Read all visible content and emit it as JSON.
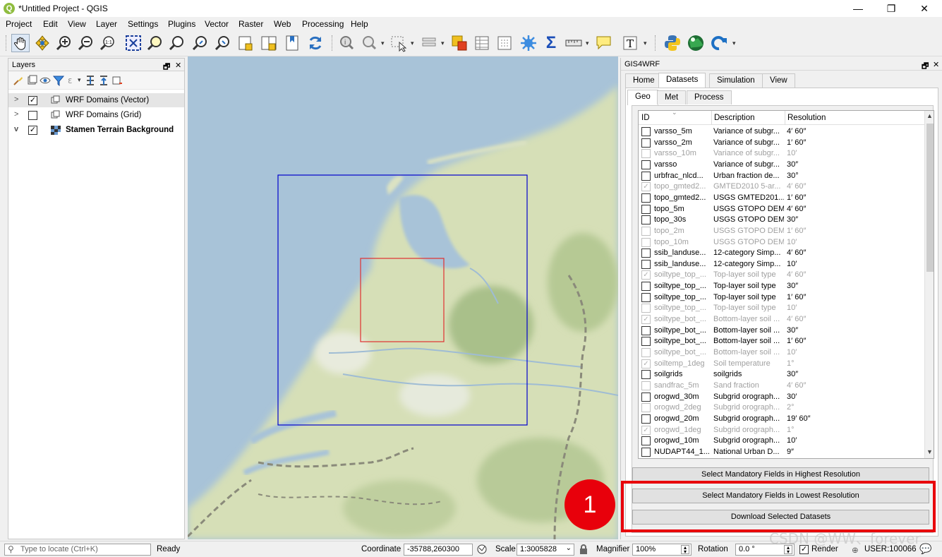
{
  "window": {
    "title": "*Untitled Project - QGIS",
    "minimize": "—",
    "maximize": "❐",
    "close": "✕"
  },
  "menu": [
    "Project",
    "Edit",
    "View",
    "Layer",
    "Settings",
    "Plugins",
    "Vector",
    "Raster",
    "Web",
    "Processing",
    "Help"
  ],
  "layers_panel": {
    "title": "Layers",
    "float": "🗗",
    "close": "✕",
    "layers": [
      {
        "name": "WRF Domains (Vector)",
        "checked": true,
        "expander": ">",
        "bold": false,
        "selected": true
      },
      {
        "name": "WRF Domains (Grid)",
        "checked": false,
        "expander": ">",
        "bold": false,
        "selected": false
      },
      {
        "name": "Stamen Terrain Background",
        "checked": true,
        "expander": "v",
        "bold": true,
        "selected": false
      }
    ]
  },
  "gis_panel": {
    "title": "GIS4WRF",
    "float": "🗗",
    "close": "✕",
    "tabs": [
      "Home",
      "Datasets",
      "Simulation",
      "View"
    ],
    "active_tab": "Datasets",
    "subtabs": [
      "Geo",
      "Met",
      "Process"
    ],
    "active_subtab": "Geo",
    "columns": [
      "ID",
      "Description",
      "Resolution"
    ],
    "rows": [
      {
        "id": "varsso_5m",
        "desc": "Variance of subgr...",
        "res": "4′ 60″",
        "checked": false,
        "disabled": false
      },
      {
        "id": "varsso_2m",
        "desc": "Variance of subgr...",
        "res": "1′ 60″",
        "checked": false,
        "disabled": false
      },
      {
        "id": "varsso_10m",
        "desc": "Variance of subgr...",
        "res": "10′",
        "checked": false,
        "disabled": true
      },
      {
        "id": "varsso",
        "desc": "Variance of subgr...",
        "res": "30″",
        "checked": false,
        "disabled": false
      },
      {
        "id": "urbfrac_nlcd...",
        "desc": "Urban fraction de...",
        "res": "30°",
        "checked": false,
        "disabled": false
      },
      {
        "id": "topo_gmted2...",
        "desc": "GMTED2010 5-ar...",
        "res": "4′ 60″",
        "checked": true,
        "disabled": true
      },
      {
        "id": "topo_gmted2...",
        "desc": "USGS GMTED201...",
        "res": "1′ 60″",
        "checked": false,
        "disabled": false
      },
      {
        "id": "topo_5m",
        "desc": "USGS GTOPO DEM",
        "res": "4′ 60″",
        "checked": false,
        "disabled": false
      },
      {
        "id": "topo_30s",
        "desc": "USGS GTOPO DEM",
        "res": "30″",
        "checked": false,
        "disabled": false
      },
      {
        "id": "topo_2m",
        "desc": "USGS GTOPO DEM",
        "res": "1′ 60″",
        "checked": false,
        "disabled": true
      },
      {
        "id": "topo_10m",
        "desc": "USGS GTOPO DEM",
        "res": "10′",
        "checked": false,
        "disabled": true
      },
      {
        "id": "ssib_landuse...",
        "desc": "12-category Simp...",
        "res": "4′ 60″",
        "checked": false,
        "disabled": false
      },
      {
        "id": "ssib_landuse...",
        "desc": "12-category Simp...",
        "res": "10′",
        "checked": false,
        "disabled": false
      },
      {
        "id": "soiltype_top_...",
        "desc": "Top-layer soil type",
        "res": "4′ 60″",
        "checked": true,
        "disabled": true
      },
      {
        "id": "soiltype_top_...",
        "desc": "Top-layer soil type",
        "res": "30″",
        "checked": false,
        "disabled": false
      },
      {
        "id": "soiltype_top_...",
        "desc": "Top-layer soil type",
        "res": "1′ 60″",
        "checked": false,
        "disabled": false
      },
      {
        "id": "soiltype_top_...",
        "desc": "Top-layer soil type",
        "res": "10′",
        "checked": false,
        "disabled": true
      },
      {
        "id": "soiltype_bot_...",
        "desc": "Bottom-layer soil ...",
        "res": "4′ 60″",
        "checked": true,
        "disabled": true
      },
      {
        "id": "soiltype_bot_...",
        "desc": "Bottom-layer soil ...",
        "res": "30″",
        "checked": false,
        "disabled": false
      },
      {
        "id": "soiltype_bot_...",
        "desc": "Bottom-layer soil ...",
        "res": "1′ 60″",
        "checked": false,
        "disabled": false
      },
      {
        "id": "soiltype_bot_...",
        "desc": "Bottom-layer soil ...",
        "res": "10′",
        "checked": false,
        "disabled": true
      },
      {
        "id": "soiltemp_1deg",
        "desc": "Soil temperature",
        "res": "1°",
        "checked": true,
        "disabled": true
      },
      {
        "id": "soilgrids",
        "desc": "soilgrids",
        "res": "30″",
        "checked": false,
        "disabled": false
      },
      {
        "id": "sandfrac_5m",
        "desc": "Sand fraction",
        "res": "4′ 60″",
        "checked": false,
        "disabled": true
      },
      {
        "id": "orogwd_30m",
        "desc": "Subgrid orograph...",
        "res": "30′",
        "checked": false,
        "disabled": false
      },
      {
        "id": "orogwd_2deg",
        "desc": "Subgrid orograph...",
        "res": "2°",
        "checked": false,
        "disabled": true
      },
      {
        "id": "orogwd_20m",
        "desc": "Subgrid orograph...",
        "res": "19′ 60″",
        "checked": false,
        "disabled": false
      },
      {
        "id": "orogwd_1deg",
        "desc": "Subgrid orograph...",
        "res": "1°",
        "checked": true,
        "disabled": true
      },
      {
        "id": "orogwd_10m",
        "desc": "Subgrid orograph...",
        "res": "10′",
        "checked": false,
        "disabled": false
      },
      {
        "id": "NUDAPT44_1...",
        "desc": "National Urban D...",
        "res": "9″",
        "checked": false,
        "disabled": false
      }
    ],
    "buttons": {
      "highest": "Select Mandatory Fields in Highest Resolution",
      "lowest": "Select Mandatory Fields in Lowest Resolution",
      "download": "Download Selected Datasets"
    }
  },
  "annotation": {
    "badge": "1",
    "color": "#e8000b"
  },
  "statusbar": {
    "locate_placeholder": "Type to locate (Ctrl+K)",
    "ready": "Ready",
    "coordinate_label": "Coordinate",
    "coordinate_value": "-35788,260300",
    "scale_label": "Scale",
    "scale_value": "1:3005828",
    "magnifier_label": "Magnifier",
    "magnifier_value": "100%",
    "rotation_label": "Rotation",
    "rotation_value": "0.0 °",
    "render_label": "Render",
    "crs": "USER:100066"
  },
  "watermark": "CSDN @WW、forever",
  "map": {
    "outer_domain_color": "#0000cc",
    "inner_domain_color": "#e03030"
  }
}
